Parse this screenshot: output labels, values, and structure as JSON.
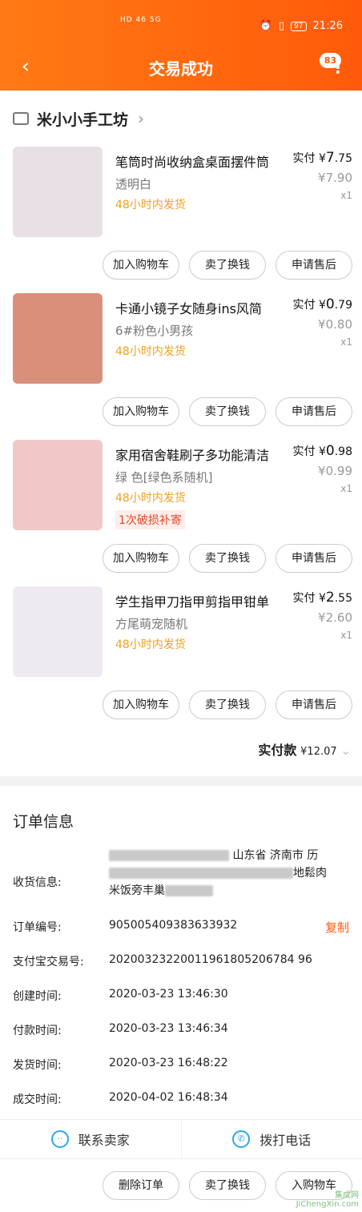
{
  "status_bar": {
    "signals": "HD 46 5G",
    "battery": "97",
    "time": "21:26"
  },
  "header": {
    "title": "交易成功",
    "badge": "83"
  },
  "shop": {
    "name": "米小小手工坊"
  },
  "items": [
    {
      "title": "笔筒时尚收纳盒桌面摆件筒",
      "spec": "透明白",
      "ship": "48小时内发货",
      "promo": "",
      "paid_label": "实付",
      "paid_int": "7",
      "paid_dec": ".75",
      "orig": "7.90",
      "qty": "x1",
      "thumb_color": "#e9e0e6"
    },
    {
      "title": "卡通小镜子女随身ins风简",
      "spec": "6#粉色小男孩",
      "ship": "48小时内发货",
      "promo": "",
      "paid_label": "实付",
      "paid_int": "0",
      "paid_dec": ".79",
      "orig": "0.80",
      "qty": "x1",
      "thumb_color": "#d9907a"
    },
    {
      "title": "家用宿舍鞋刷子多功能清洁",
      "spec": "绿 色[绿色系随机]",
      "ship": "48小时内发货",
      "promo": "1次破损补寄",
      "paid_label": "实付",
      "paid_int": "0",
      "paid_dec": ".98",
      "orig": "0.99",
      "qty": "x1",
      "thumb_color": "#f0c8c8"
    },
    {
      "title": "学生指甲刀指甲剪指甲钳单",
      "spec": "方尾萌宠随机",
      "ship": "48小时内发货",
      "promo": "",
      "paid_label": "实付",
      "paid_int": "2",
      "paid_dec": ".55",
      "orig": "2.60",
      "qty": "x1",
      "thumb_color": "#efeaf2"
    }
  ],
  "item_buttons": {
    "cart": "加入购物车",
    "resell": "卖了换钱",
    "after_sale": "申请售后"
  },
  "total": {
    "label": "实付款",
    "amount": "12.07"
  },
  "order": {
    "title": "订单信息",
    "address_label": "收货信息:",
    "address_line1": "山东省 济南市 历",
    "address_line2": "地鬆肉",
    "address_line3": "米饭旁丰巢",
    "order_no_label": "订单编号:",
    "order_no": "905005409383633932",
    "copy": "复制",
    "alipay_label": "支付宝交易号:",
    "alipay_no": "20200323220011961805206784 96",
    "created_label": "创建时间:",
    "created": "2020-03-23 13:46:30",
    "paid_label": "付款时间:",
    "paid": "2020-03-23 13:46:34",
    "shipped_label": "发货时间:",
    "shipped": "2020-03-23 16:48:22",
    "done_label": "成交时间:",
    "done": "2020-04-02 16:48:34"
  },
  "actions": {
    "contact": "联系卖家",
    "call": "拨打电话"
  },
  "bottom": {
    "delete": "删除订单",
    "resell": "卖了换钱",
    "cart": "入购物车"
  },
  "watermark": {
    "line1": "集成网",
    "line2": "JiChengXin.com"
  }
}
